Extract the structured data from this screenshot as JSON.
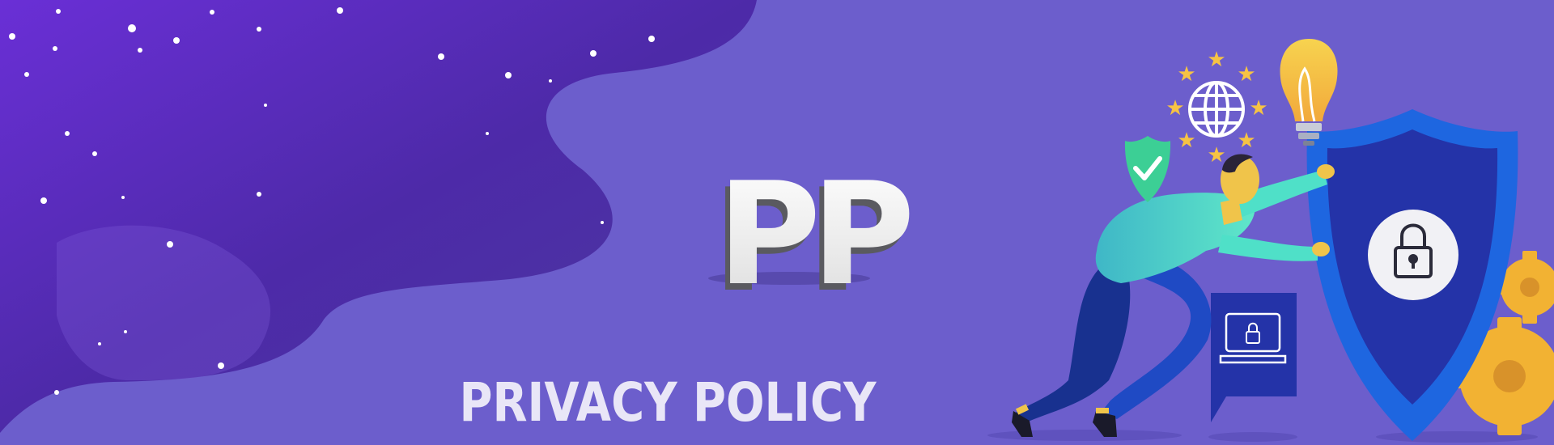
{
  "banner": {
    "logo_text": "PP",
    "title": "PRIVACY POLICY"
  },
  "icons": [
    "star-icon",
    "globe-icon",
    "lightbulb-icon",
    "shield-check-icon",
    "padlock-icon",
    "laptop-lock-icon",
    "gear-icon"
  ],
  "colors": {
    "background": "#6c5ecc",
    "night_sky_dark": "#4a2aa0",
    "night_sky_light": "#5f2ac8",
    "title_text": "#e9e6f7",
    "shield_outer": "#1e66e0",
    "shield_inner": "#2433a8",
    "person_top": "#4fe0c8",
    "person_pants": "#1c3fb0",
    "skin": "#f0c44a",
    "star": "#f6c344",
    "gear": "#f2b233",
    "check_shield": "#3ccf95"
  }
}
